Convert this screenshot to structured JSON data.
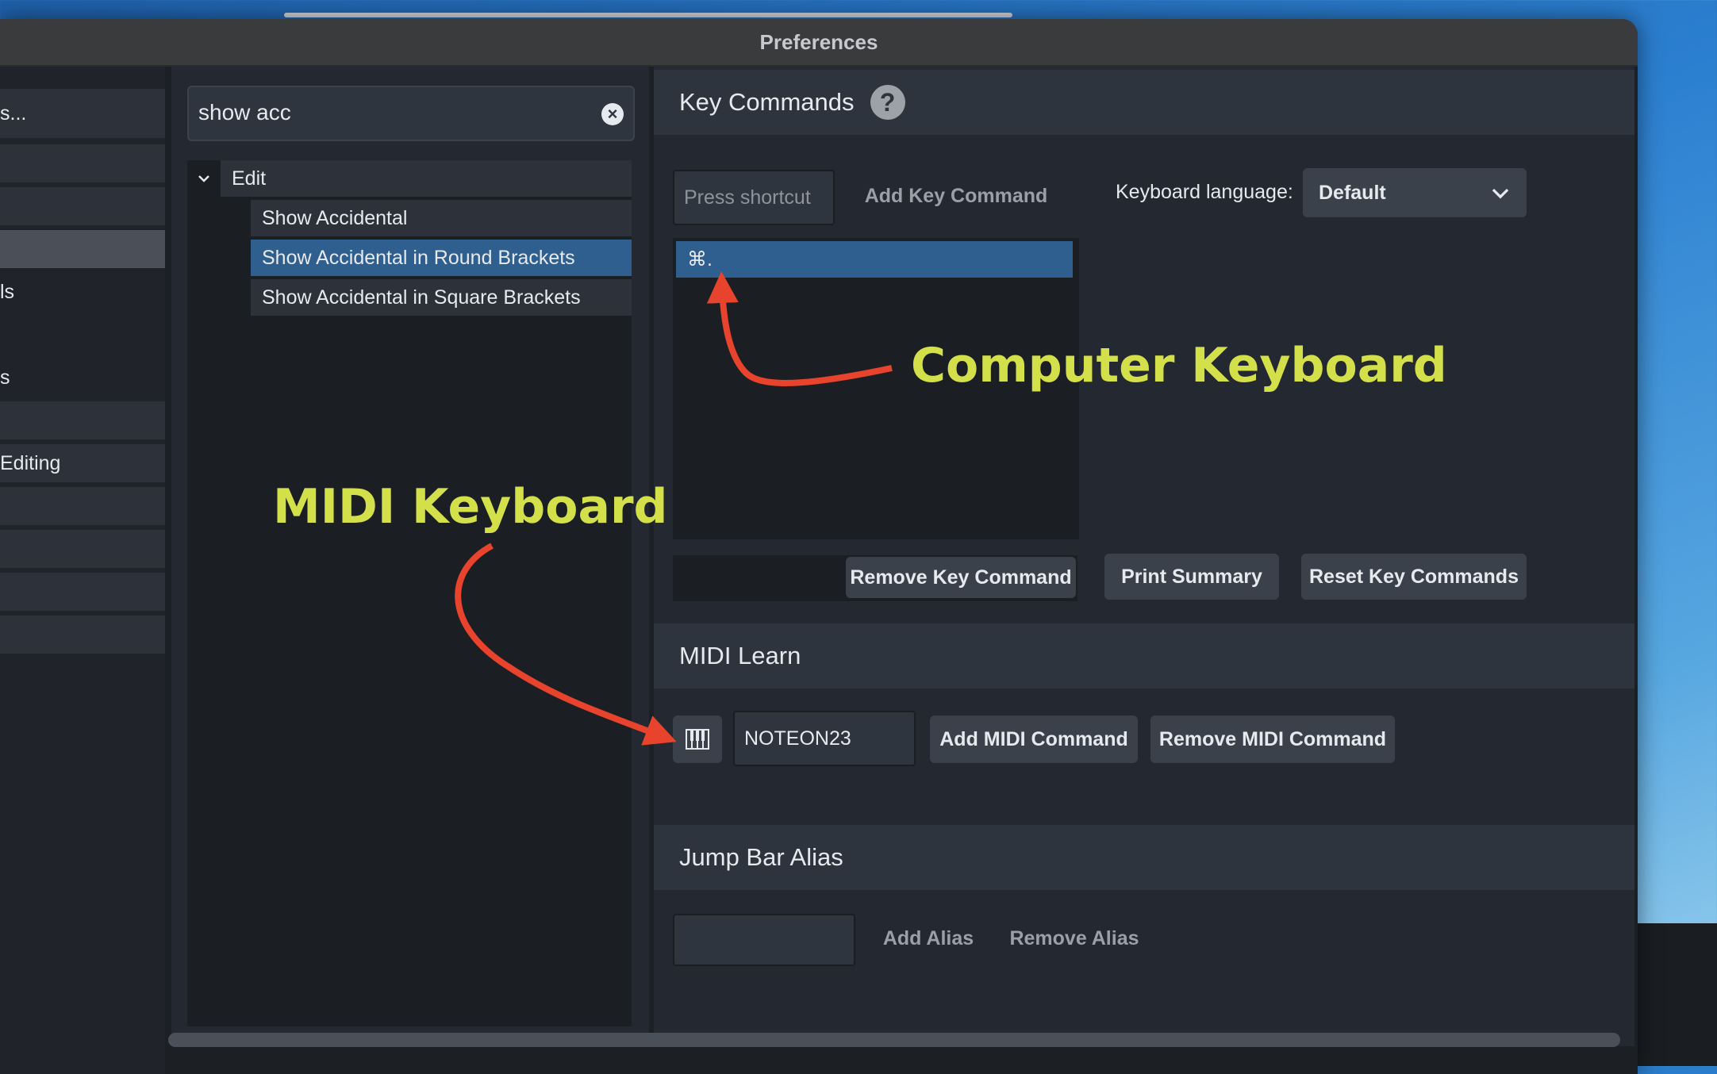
{
  "window": {
    "title": "Preferences"
  },
  "categories": [
    {
      "label": "s...",
      "state": "normal"
    },
    {
      "label": "",
      "state": "normal"
    },
    {
      "label": "",
      "state": "normal"
    },
    {
      "label": "",
      "state": "selected"
    },
    {
      "label": "ls",
      "state": "plain"
    },
    {
      "label": "s",
      "state": "plain"
    },
    {
      "label": "",
      "state": "normal"
    },
    {
      "label": "Editing",
      "state": "normal"
    },
    {
      "label": "",
      "state": "normal"
    },
    {
      "label": "",
      "state": "normal"
    },
    {
      "label": "",
      "state": "normal"
    },
    {
      "label": "",
      "state": "normal"
    }
  ],
  "search": {
    "value": "show acc",
    "clear_icon": "×"
  },
  "tree": {
    "group_label": "Edit",
    "items": [
      {
        "label": "Show Accidental"
      },
      {
        "label": "Show Accidental in Round Brackets"
      },
      {
        "label": "Show Accidental in Square Brackets"
      }
    ]
  },
  "key_commands": {
    "title": "Key Commands",
    "help_icon": "?",
    "shortcut_placeholder": "Press shortcut",
    "add_label": "Add Key Command",
    "keyboard_language_label": "Keyboard language:",
    "keyboard_language_value": "Default",
    "shortcuts": [
      "⌘."
    ],
    "remove_label": "Remove Key Command",
    "print_label": "Print Summary",
    "reset_label": "Reset Key Commands"
  },
  "midi_learn": {
    "title": "MIDI Learn",
    "value": "NOTEON23",
    "add_label": "Add MIDI Command",
    "remove_label": "Remove MIDI Command"
  },
  "jump_bar": {
    "title": "Jump Bar Alias",
    "add_label": "Add Alias",
    "remove_label": "Remove Alias"
  },
  "annotations": {
    "computer_keyboard": "Computer Keyboard",
    "midi_keyboard": "MIDI Keyboard"
  },
  "colors": {
    "selection": "#2e5f8e",
    "annotation_text": "#d4e04a",
    "annotation_arrow": "#e8432c"
  }
}
